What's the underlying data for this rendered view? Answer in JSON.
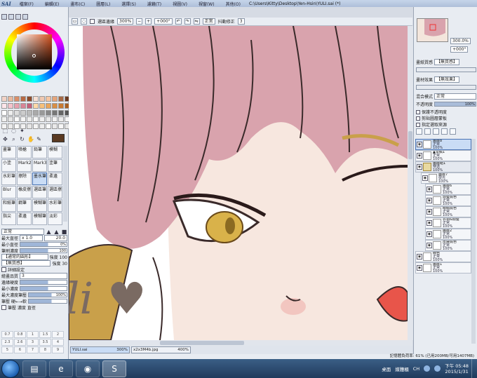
{
  "app": {
    "logo": "SAI",
    "title": "C:\\Users\\Kitty\\Desktop\\Yen-Hsin\\YULI.sai (*)",
    "menu": [
      "檔案(F)",
      "編輯(E)",
      "畫布(C)",
      "圖層(L)",
      "選擇(S)",
      "濾鏡(T)",
      "視圖(V)",
      "視窗(W)",
      "其他(O)"
    ]
  },
  "toolbar": {
    "antialias_label": "選區邊緣",
    "zoom_value": "300%",
    "rotation_value": "+000°",
    "blend_value": "正常",
    "stabilizer_label": "抖動修正",
    "stabilizer_value": "3"
  },
  "left": {
    "brush_tools": [
      "畫筆",
      "噴槍",
      "鉛筆",
      "模糊",
      "小塗",
      "Mark2",
      "Mark3",
      "塗筆",
      "水彩筆",
      "擦除",
      "墨水筆",
      "柔邊",
      "Blur",
      "橡皮擦",
      "選區筆",
      "選區擦",
      "和紙筆",
      "鋼筆",
      "模糊筆",
      "水彩筆",
      "指尖",
      "柔邊",
      "模糊筆",
      "淡彩"
    ],
    "selected_brush_index": 10,
    "blend_mode": "正常",
    "max_size_label": "最大直徑",
    "max_size_multiplier": "x 1.0",
    "max_size_value": "20.0",
    "min_size_label": "最小直徑",
    "min_size_value": "0%",
    "density_label": "筆刷濃度",
    "density_value": "100",
    "shape_label": "【通常的圓形】",
    "shape_strength": "強度 100",
    "texture_label": "【無質感】",
    "texture_strength": "強度 30",
    "detail_label": "詳細設定",
    "quality_label": "繪畫品質",
    "quality_value": "3",
    "edge_label": "邊緣硬度",
    "min_density_label": "最小濃度",
    "max_pressure_label": "最大濃度筆壓",
    "pressure_label": "筆壓 硬←→軟",
    "pressure_value": "100%",
    "checks_label": "筆壓 濃度 直徑",
    "sizes": [
      "0.7",
      "0.8",
      "1",
      "1.5",
      "2",
      "2.3",
      "2.6",
      "3",
      "3.5",
      "4",
      "5",
      "6",
      "7",
      "8",
      "9"
    ]
  },
  "right": {
    "zoom_label": "縮放",
    "zoom_value": "300.0%",
    "rotate_label": "旋轉",
    "rotate_value": "+000°",
    "paper_texture_label": "畫紙質感",
    "paper_texture_value": "【無質感】",
    "paper_effect_label": "畫材效果",
    "paper_effect_value": "【無效果】",
    "blend_mode_label": "混合模式",
    "blend_mode_value": "正常",
    "opacity_label": "不透明度",
    "opacity_value": "100%",
    "check1": "保護不透明度",
    "check2": "剪貼圖層蒙板",
    "check3": "指定選取來源",
    "layers": [
      {
        "name": "圖層8",
        "mode": "正常",
        "opacity": "100%",
        "state": "sel",
        "indent": 0
      },
      {
        "name": "▲草稿1",
        "mode": "正常",
        "opacity": "100%",
        "state": "",
        "indent": 0
      },
      {
        "name": "圖層組1",
        "mode": "穿透",
        "opacity": "100%",
        "state": "folder",
        "indent": 0
      },
      {
        "name": "圖層7",
        "mode": "發光",
        "opacity": "100%",
        "state": "",
        "indent": 1
      },
      {
        "name": "圖層6",
        "mode": "正常",
        "opacity": "100%",
        "state": "",
        "indent": 2
      },
      {
        "name": "頭髮底色",
        "mode": "正常",
        "opacity": "100%",
        "state": "",
        "indent": 2
      },
      {
        "name": "眼睛底色",
        "mode": "正常",
        "opacity": "100%",
        "state": "",
        "indent": 2
      },
      {
        "name": "衣領&頭髮",
        "mode": "正常",
        "opacity": "100%",
        "state": "",
        "indent": 2
      },
      {
        "name": "圖層2",
        "mode": "正常",
        "opacity": "100%",
        "state": "",
        "indent": 2
      },
      {
        "name": "皮膚底色",
        "mode": "正常",
        "opacity": "100%",
        "state": "",
        "indent": 2
      },
      {
        "name": "線色",
        "mode": "正常",
        "opacity": "100%",
        "state": "",
        "indent": 0
      },
      {
        "name": "圖層1",
        "mode": "正常",
        "opacity": "100%",
        "state": "",
        "indent": 0
      }
    ]
  },
  "doc_tabs": [
    {
      "name": "YULI.sai",
      "zoom": "300%",
      "active": true
    },
    {
      "name": "x2x3M4b.jpg",
      "zoom": "400%",
      "active": false
    }
  ],
  "status": "記憶體負荷率: 61% (已用200MB/可用1407MB)",
  "taskbar": {
    "desktop_label": "桌面",
    "media_label": "媒體櫃",
    "lang": "CH",
    "time": "下午 05:48",
    "date": "2015/1/31"
  },
  "colors": {
    "selected_color": "#5a3a22",
    "hair": "#d9a3ad",
    "eye": "#d9b24a",
    "skin": "#f7e7df",
    "accent": "#4a74b4"
  },
  "swatch_colors": [
    "#f2d3c6",
    "#e9b99e",
    "#d98f6a",
    "#b96a44",
    "#8c4b2b",
    "#f7e0d4",
    "#f0c8b0",
    "#f5c6a3",
    "#e6a57b",
    "#a86a45",
    "#6a3a22",
    "#ffe6ea",
    "#f5c3cc",
    "#e7a0ae",
    "#d98596",
    "#c4617a",
    "#ffd9a8",
    "#f7c07a",
    "#e9a55a",
    "#d88e45",
    "#c97a32",
    "#a85f22",
    "#ffffff",
    "#eeeeee",
    "#dddddd",
    "#cccccc",
    "#bbbbbb",
    "#aaaaaa",
    "#999999",
    "#888888",
    "#777777",
    "#666666",
    "#555555",
    "#f0f0f0",
    "#e5e5e5",
    "#fafafa",
    "#f5f5f5",
    "#ececec",
    "#f8f8f8",
    "#efefef",
    "#e8e8e8",
    "#f2f2f2",
    "#ebebeb",
    "#f6f6f6",
    "#f3f3f3",
    "#eaeaea",
    "#f9f9f9",
    "#f1f1f1",
    "#e7e7e7",
    "#f4f4f4",
    "#ededed",
    "#fbfbfb",
    "#e9e9e9",
    "#f7f7f7",
    "#e6e6e6"
  ],
  "icons": [
    "start-orb",
    "explorer-folder-icon",
    "internet-explorer-icon",
    "chrome-icon",
    "paint-tool-sai-icon"
  ],
  "signature": "Yuli ♥"
}
